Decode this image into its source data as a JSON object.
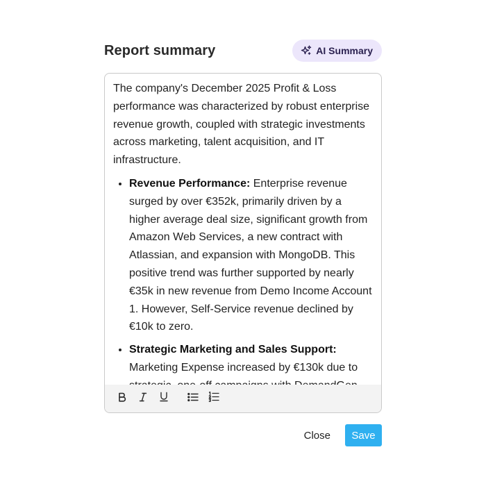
{
  "dialog": {
    "title": "Report summary",
    "ai_button": {
      "label": "AI Summary",
      "icon": "sparkles-icon",
      "background": "#ece6fb",
      "text_color": "#2b2150"
    }
  },
  "editor": {
    "intro": "The company's December 2025 Profit & Loss performance was characterized by robust enterprise revenue growth, coupled with strategic investments across marketing, talent acquisition, and IT infrastructure.",
    "bullets": [
      {
        "heading": "Revenue Performance:",
        "text": " Enterprise revenue surged by over €352k, primarily driven by a higher average deal size, significant growth from Amazon Web Services, a new contract with Atlassian, and expansion with MongoDB. This positive trend was further supported by nearly €35k in new revenue from Demo Income Account 1. However, Self-Service revenue declined by €10k to zero."
      },
      {
        "heading": "Strategic Marketing and Sales Support:",
        "text": " Marketing Expense increased by €130k due to strategic, one-off campaigns with DemandGen"
      }
    ],
    "toolbar": [
      {
        "name": "bold-icon"
      },
      {
        "name": "italic-icon"
      },
      {
        "name": "underline-icon"
      },
      {
        "name": "bullet-list-icon"
      },
      {
        "name": "numbered-list-icon"
      }
    ]
  },
  "footer": {
    "close_label": "Close",
    "save_label": "Save",
    "save_color": "#2fb0f0"
  }
}
